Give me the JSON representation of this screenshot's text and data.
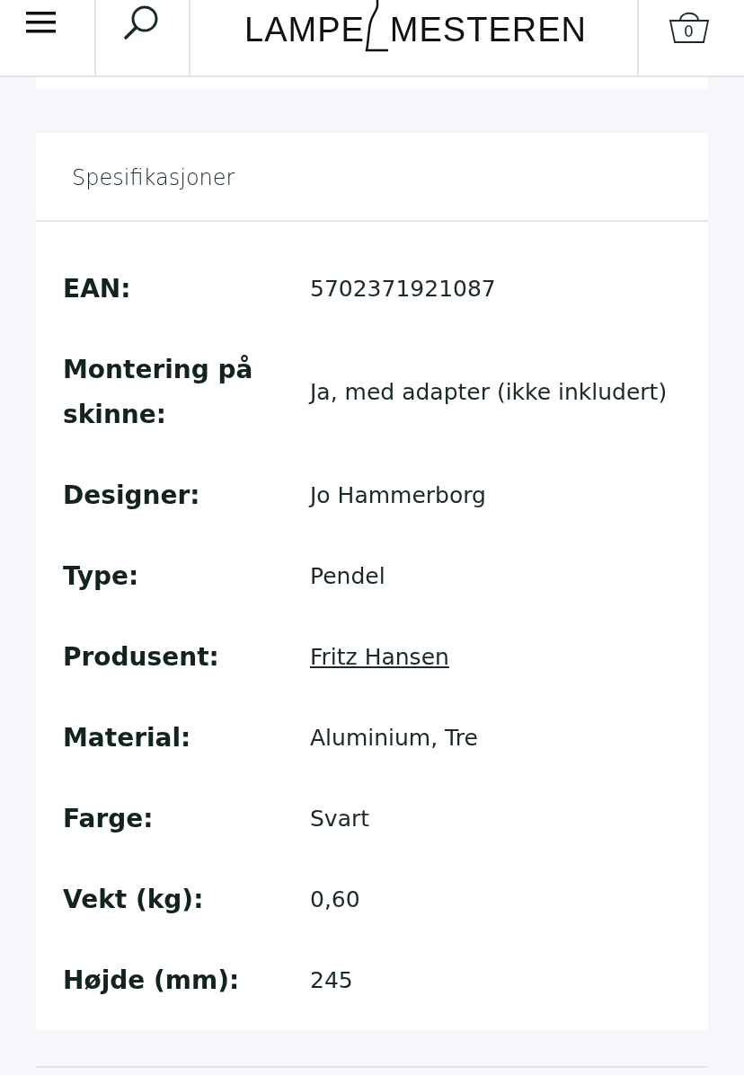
{
  "header": {
    "logo": {
      "left": "LAMPE",
      "right": "MESTEREN"
    },
    "cart_count": "0"
  },
  "specifications": {
    "title": "Spesifikasjoner",
    "rows": [
      {
        "label": "EAN:",
        "value": "5702371921087",
        "kind": "text"
      },
      {
        "label": "Montering på skinne:",
        "value": "Ja, med adapter (ikke inkludert)",
        "kind": "text"
      },
      {
        "label": "Designer:",
        "value": "Jo Hammerborg",
        "kind": "text"
      },
      {
        "label": "Type:",
        "value": "Pendel",
        "kind": "text"
      },
      {
        "label": "Produsent:",
        "value": "Fritz Hansen",
        "kind": "link"
      },
      {
        "label": "Material:",
        "value": "Aluminium, Tre",
        "kind": "text"
      },
      {
        "label": "Farge:",
        "value": "Svart",
        "kind": "text"
      },
      {
        "label": "Vekt (kg):",
        "value": "0,60",
        "kind": "text"
      },
      {
        "label": "Højde (mm):",
        "value": "245",
        "kind": "text"
      }
    ]
  }
}
